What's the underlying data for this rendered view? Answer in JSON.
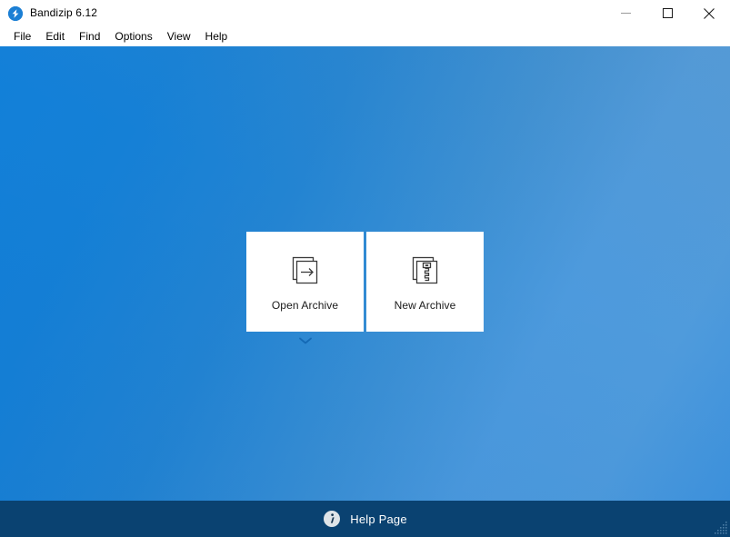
{
  "window": {
    "title": "Bandizip 6.12",
    "app_icon": "bandizip-logo-icon",
    "controls": {
      "minimize": "minimize-icon",
      "maximize": "maximize-icon",
      "close": "close-icon"
    }
  },
  "menu": {
    "items": [
      {
        "label": "File"
      },
      {
        "label": "Edit"
      },
      {
        "label": "Find"
      },
      {
        "label": "Options"
      },
      {
        "label": "View"
      },
      {
        "label": "Help"
      }
    ]
  },
  "main": {
    "cards": [
      {
        "label": "Open Archive",
        "icon": "open-archive-icon"
      },
      {
        "label": "New Archive",
        "icon": "new-archive-icon"
      }
    ],
    "expander_icon": "chevron-down-icon"
  },
  "help_bar": {
    "label": "Help Page",
    "icon": "info-icon"
  },
  "colors": {
    "accent_blue": "#1280d9",
    "canvas_light_blue": "#4f9bdc",
    "help_bar_navy": "#0a4271",
    "card_white": "#ffffff",
    "text_dark": "#1a1a1a"
  }
}
